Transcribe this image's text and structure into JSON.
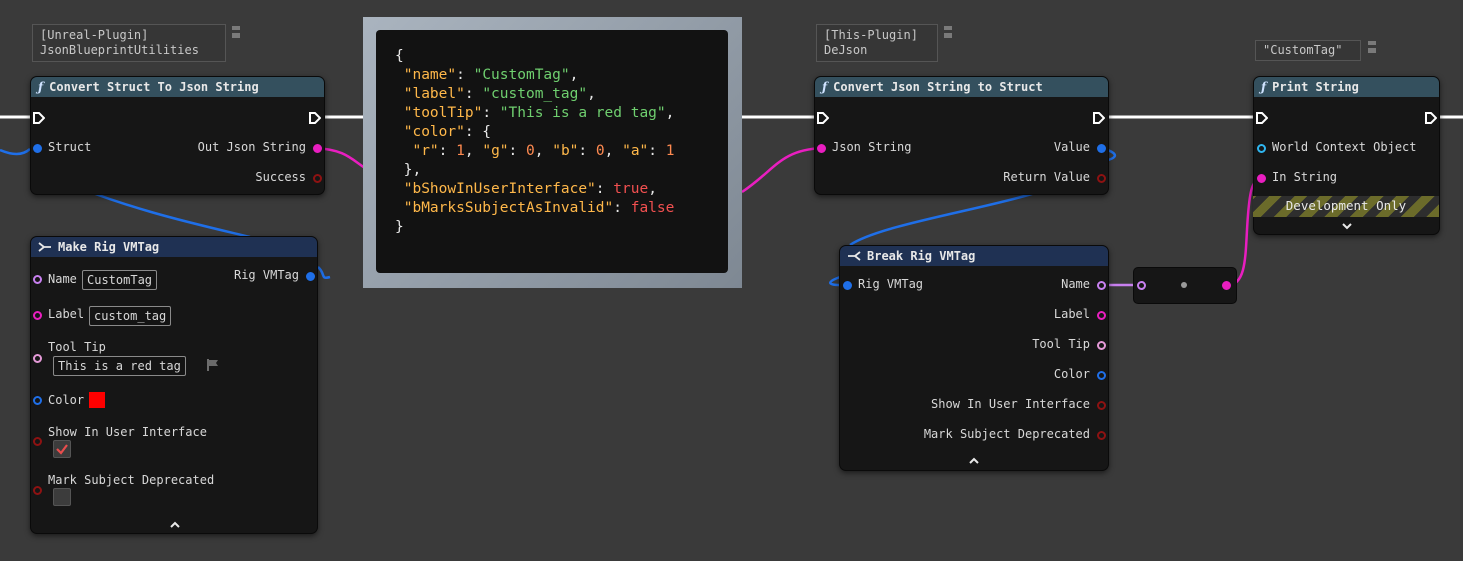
{
  "comments": {
    "unreal_plugin": {
      "line1": "[Unreal-Plugin]",
      "line2": "JsonBlueprintUtilities"
    },
    "this_plugin": {
      "line1": "[This-Plugin]",
      "line2": "DeJson"
    },
    "print_literal": "\"CustomTag\""
  },
  "nodes": {
    "convert_struct_to_json": {
      "title": "Convert Struct To Json String",
      "pins": {
        "struct": "Struct",
        "out_json": "Out Json String",
        "success": "Success"
      }
    },
    "make_rig_vmtag": {
      "title": "Make Rig VMTag",
      "pins": {
        "name": "Name",
        "label": "Label",
        "tool_tip": "Tool Tip",
        "color": "Color",
        "show_in_ui": "Show In User Interface",
        "mark_deprecated": "Mark Subject Deprecated",
        "output": "Rig VMTag"
      },
      "values": {
        "name": "CustomTag",
        "label": "custom_tag",
        "tool_tip": "This is a red tag",
        "color": "#ff0000",
        "show_in_ui": true,
        "mark_deprecated": false
      }
    },
    "convert_json_to_struct": {
      "title": "Convert Json String to Struct",
      "pins": {
        "json_string": "Json String",
        "value": "Value",
        "return_value": "Return Value"
      }
    },
    "break_rig_vmtag": {
      "title": "Break Rig VMTag",
      "pins": {
        "input": "Rig VMTag",
        "name": "Name",
        "label": "Label",
        "tool_tip": "Tool Tip",
        "color": "Color",
        "show_in_ui": "Show In User Interface",
        "mark_deprecated": "Mark Subject Deprecated"
      }
    },
    "print_string": {
      "title": "Print String",
      "pins": {
        "world_context": "World Context Object",
        "in_string": "In String"
      },
      "dev_only": "Development Only"
    }
  },
  "json_preview": {
    "open": "{",
    "l1_key": "\"name\"",
    "l1_val": "\"CustomTag\"",
    "l2_key": "\"label\"",
    "l2_val": "\"custom_tag\"",
    "l3_key": "\"toolTip\"",
    "l3_val": "\"This is a red tag\"",
    "l4_key": "\"color\"",
    "r_key": "\"r\"",
    "r_val": "1",
    "g_key": "\"g\"",
    "g_val": "0",
    "b_key": "\"b\"",
    "b_val": "0",
    "a_key": "\"a\"",
    "a_val": "1",
    "l6_key": "\"bShowInUserInterface\"",
    "l6_val": "true",
    "l7_key": "\"bMarksSubjectAsInvalid\"",
    "l7_val": "false",
    "close": "}"
  },
  "icons": [
    "function-icon",
    "exec-pin-icon",
    "make-struct-icon",
    "break-struct-icon",
    "comment-pin-icon",
    "chevron-up-icon",
    "chevron-down-icon",
    "checkmark-icon",
    "flag-icon"
  ],
  "colors": {
    "struct_pin": "#1f6fe8",
    "string_pin": "#e91ec0",
    "bool_pin": "#8e1212",
    "name_pin": "#c880f0",
    "text_pin": "#e59ad8",
    "object_pin": "#2fb6f0",
    "func_header": "#34505e",
    "struct_header": "#1f3153"
  }
}
